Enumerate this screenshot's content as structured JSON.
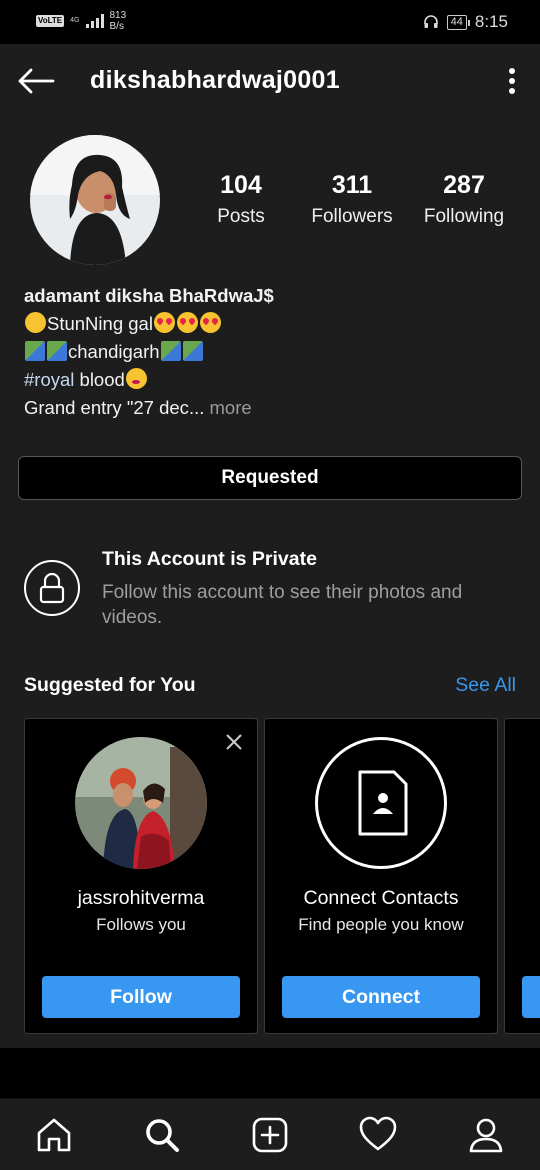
{
  "status_bar": {
    "network_badge": "VoLTE",
    "network_type": "4G",
    "speed_value": "813",
    "speed_unit": "B/s",
    "battery": "44",
    "time": "8:15"
  },
  "header": {
    "username": "dikshabhardwaj0001"
  },
  "profile": {
    "stats": [
      {
        "value": "104",
        "label": "Posts"
      },
      {
        "value": "311",
        "label": "Followers"
      },
      {
        "value": "287",
        "label": "Following"
      }
    ],
    "bio": {
      "name": "adamant diksha BhaRdwaJ$",
      "line1": "StunNing gal",
      "line2": "chandigarh",
      "line3_tag": "#royal",
      "line3_text": " blood",
      "line4": "Grand entry \"27 dec",
      "line4_ellipsis": "...",
      "more": " more"
    },
    "requested_button": "Requested"
  },
  "private_notice": {
    "title": "This Account is Private",
    "subtitle": "Follow this account to see their photos and videos."
  },
  "suggestions": {
    "title": "Suggested for You",
    "see_all": "See All",
    "cards": [
      {
        "title": "jassrohitverma",
        "subtitle": "Follows you",
        "button": "Follow"
      },
      {
        "title": "Connect Contacts",
        "subtitle": "Find people you know",
        "button": "Connect"
      }
    ]
  },
  "bottom_nav": {
    "icons": [
      "home-icon",
      "search-icon",
      "add-post-icon",
      "activity-heart-icon",
      "profile-icon"
    ]
  },
  "colors": {
    "accent": "#3897f0",
    "background": "#1d1d1d"
  }
}
